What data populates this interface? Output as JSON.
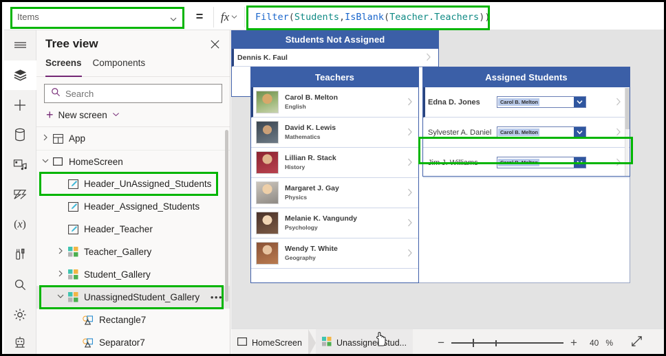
{
  "formula_bar": {
    "property_value": "Items",
    "equals": "=",
    "fx_label": "fx",
    "formula_tokens": [
      {
        "t": "Filter",
        "c": "fn"
      },
      {
        "t": "(",
        "c": "punc"
      },
      {
        "t": "Students",
        "c": "tbl"
      },
      {
        "t": ",",
        "c": "punc"
      },
      {
        "t": "IsBlank",
        "c": "fn"
      },
      {
        "t": "(",
        "c": "punc"
      },
      {
        "t": "Teacher.Teachers",
        "c": "col"
      },
      {
        "t": "))",
        "c": "punc"
      }
    ],
    "formula_text": "Filter(Students,IsBlank(Teacher.Teachers))"
  },
  "rail": {
    "items": [
      {
        "name": "hamburger-menu-icon",
        "label": "Menu"
      },
      {
        "name": "tree-view-layers-icon",
        "label": "Tree view"
      },
      {
        "name": "insert-plus-icon",
        "label": "Insert"
      },
      {
        "name": "data-cylinder-icon",
        "label": "Data"
      },
      {
        "name": "media-icon",
        "label": "Media"
      },
      {
        "name": "power-automate-icon",
        "label": "Power Automate"
      },
      {
        "name": "variables-x-icon",
        "label": "Variables"
      },
      {
        "name": "tools-icon",
        "label": "Tools"
      },
      {
        "name": "search-magnifier-icon",
        "label": "Search"
      },
      {
        "name": "settings-gear-icon",
        "label": "Settings"
      },
      {
        "name": "copilot-robot-icon",
        "label": "Copilot"
      }
    ]
  },
  "tree_view": {
    "title": "Tree view",
    "tabs": [
      {
        "label": "Screens",
        "active": true
      },
      {
        "label": "Components",
        "active": false
      }
    ],
    "search_placeholder": "Search",
    "new_screen_label": "New screen",
    "items": [
      {
        "label": "App",
        "indent": 0,
        "twisty": "collapsed",
        "icon": "app-icon"
      },
      {
        "label": "HomeScreen",
        "indent": 0,
        "twisty": "expanded",
        "icon": "screen-icon"
      },
      {
        "label": "Header_UnAssigned_Students",
        "indent": 1,
        "twisty": "none",
        "icon": "label-icon",
        "highlighted": true
      },
      {
        "label": "Header_Assigned_Students",
        "indent": 1,
        "twisty": "none",
        "icon": "label-icon"
      },
      {
        "label": "Header_Teacher",
        "indent": 1,
        "twisty": "none",
        "icon": "label-icon"
      },
      {
        "label": "Teacher_Gallery",
        "indent": 1,
        "twisty": "collapsed",
        "icon": "gallery-icon"
      },
      {
        "label": "Student_Gallery",
        "indent": 1,
        "twisty": "collapsed",
        "icon": "gallery-icon"
      },
      {
        "label": "UnassignedStudent_Gallery",
        "indent": 1,
        "twisty": "expanded",
        "icon": "gallery-icon",
        "selected": true,
        "highlighted": true,
        "overflow": "•••"
      },
      {
        "label": "Rectangle7",
        "indent": 2,
        "twisty": "none",
        "icon": "shape-icon"
      },
      {
        "label": "Separator7",
        "indent": 2,
        "twisty": "none",
        "icon": "shape-icon"
      }
    ]
  },
  "canvas": {
    "teachers_gallery": {
      "header": "Teachers",
      "rows": [
        {
          "name": "Carol B. Melton",
          "subject": "English"
        },
        {
          "name": "David K. Lewis",
          "subject": "Mathematics"
        },
        {
          "name": "Lillian R. Stack",
          "subject": "History"
        },
        {
          "name": "Margaret J. Gay",
          "subject": "Physics"
        },
        {
          "name": "Melanie K. Vangundy",
          "subject": "Psychology"
        },
        {
          "name": "Wendy T. White",
          "subject": "Geography"
        }
      ]
    },
    "assigned_students_gallery": {
      "header": "Assigned Students",
      "rows": [
        {
          "student": "Edna D. Jones",
          "teacher": "Carol B. Melton"
        },
        {
          "student": "Sylvester A. Daniel",
          "teacher": "Carol B. Melton"
        },
        {
          "student": "Jim J. Williams",
          "teacher": "Carol B. Melton"
        }
      ]
    },
    "unassigned_students_gallery": {
      "header": "Students Not Assigned",
      "rows": [
        {
          "student": "Dennis K. Faul"
        }
      ]
    }
  },
  "bottom_bar": {
    "breadcrumb": [
      {
        "label": "HomeScreen",
        "icon": "screen-icon"
      },
      {
        "label": "UnassignedStud...",
        "icon": "gallery-icon"
      }
    ],
    "zoom_out": "−",
    "zoom_in": "+",
    "zoom_value": "40",
    "zoom_unit": "%"
  },
  "colors": {
    "highlight_green": "#00b500",
    "gallery_header_blue": "#3b5fa7",
    "accent_purple": "#742774",
    "formula_fn_blue": "#1a66cc",
    "formula_table_teal": "#0f8a84"
  }
}
